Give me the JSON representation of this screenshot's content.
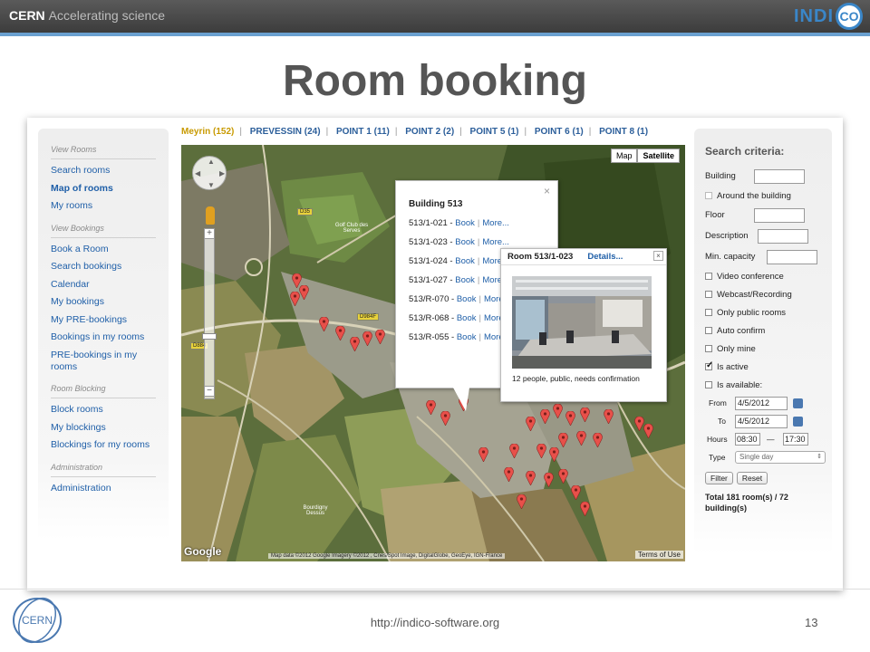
{
  "header": {
    "brand": "CERN",
    "tagline": "Accelerating science",
    "logo_text": "INDI",
    "logo_circle": "CO"
  },
  "slide_title": "Room booking",
  "sidebar": {
    "sections": [
      {
        "heading": "View Rooms",
        "items": [
          {
            "label": "Search rooms",
            "active": false
          },
          {
            "label": "Map of rooms",
            "active": true
          },
          {
            "label": "My rooms",
            "active": false
          }
        ]
      },
      {
        "heading": "View Bookings",
        "items": [
          {
            "label": "Book a Room",
            "active": false
          },
          {
            "label": "Search bookings",
            "active": false
          },
          {
            "label": "Calendar",
            "active": false
          },
          {
            "label": "My bookings",
            "active": false
          },
          {
            "label": "My PRE-bookings",
            "active": false
          },
          {
            "label": "Bookings in my rooms",
            "active": false
          },
          {
            "label": "PRE-bookings in my rooms",
            "active": false
          }
        ]
      },
      {
        "heading": "Room Blocking",
        "items": [
          {
            "label": "Block rooms",
            "active": false
          },
          {
            "label": "My blockings",
            "active": false
          },
          {
            "label": "Blockings for my rooms",
            "active": false
          }
        ]
      },
      {
        "heading": "Administration",
        "items": [
          {
            "label": "Administration",
            "active": false
          }
        ]
      }
    ]
  },
  "site_tabs": [
    {
      "label": "Meyrin (152)",
      "active": true
    },
    {
      "label": "PREVESSIN (24)",
      "active": false
    },
    {
      "label": "POINT 1 (11)",
      "active": false
    },
    {
      "label": "POINT 2 (2)",
      "active": false
    },
    {
      "label": "POINT 5 (1)",
      "active": false
    },
    {
      "label": "POINT 6 (1)",
      "active": false
    },
    {
      "label": "POINT 8 (1)",
      "active": false
    }
  ],
  "map": {
    "type_buttons": {
      "map": "Map",
      "satellite": "Satellite"
    },
    "selected_type": "Satellite",
    "google_logo": "Google",
    "credit": "Map data ©2012 Google Imagery ©2012 , Cnes/Spot Image, DigitalGlobe, GeoEye, IGN-France",
    "terms": "Terms of Use",
    "zoom_in": "+",
    "zoom_out": "−",
    "labels": {
      "golf": "Golf Club des Serves",
      "bourdigny": "Bourdigny Dessus",
      "road1": "D35",
      "road2": "D984F",
      "road3": "D884"
    }
  },
  "building_popup": {
    "title": "Building 513",
    "close": "×",
    "book_label": "Book",
    "more_label": "More...",
    "rooms": [
      "513/1-021",
      "513/1-023",
      "513/1-024",
      "513/1-027",
      "513/R-070",
      "513/R-068",
      "513/R-055"
    ]
  },
  "room_popup": {
    "title": "Room 513/1-023",
    "details": "Details...",
    "close": "×",
    "description": "12 people, public, needs confirmation"
  },
  "search": {
    "title": "Search criteria:",
    "building_label": "Building",
    "around_label": "Around the building",
    "floor_label": "Floor",
    "description_label": "Description",
    "capacity_label": "Min. capacity",
    "checkboxes": [
      {
        "label": "Video conference",
        "checked": false
      },
      {
        "label": "Webcast/Recording",
        "checked": false
      },
      {
        "label": "Only public rooms",
        "checked": false
      },
      {
        "label": "Auto confirm",
        "checked": false
      },
      {
        "label": "Only mine",
        "checked": false
      },
      {
        "label": "Is active",
        "checked": true
      },
      {
        "label": "Is available:",
        "checked": false
      }
    ],
    "from_label": "From",
    "from_value": "4/5/2012",
    "to_label": "To",
    "to_value": "4/5/2012",
    "hours_label": "Hours",
    "hours_from": "08:30",
    "hours_sep": "—",
    "hours_to": "17:30",
    "type_label": "Type",
    "type_value": "Single day",
    "filter_button": "Filter",
    "reset_button": "Reset",
    "total": "Total 181 room(s) / 72 building(s)"
  },
  "footer": {
    "url": "http://indico-software.org",
    "page_number": "13",
    "logo_text": "CERN"
  },
  "colors": {
    "accent": "#1f5fa8",
    "tab_active": "#c89a00",
    "pin": "#e8504a",
    "header_stripe": "#6aa0d0"
  }
}
